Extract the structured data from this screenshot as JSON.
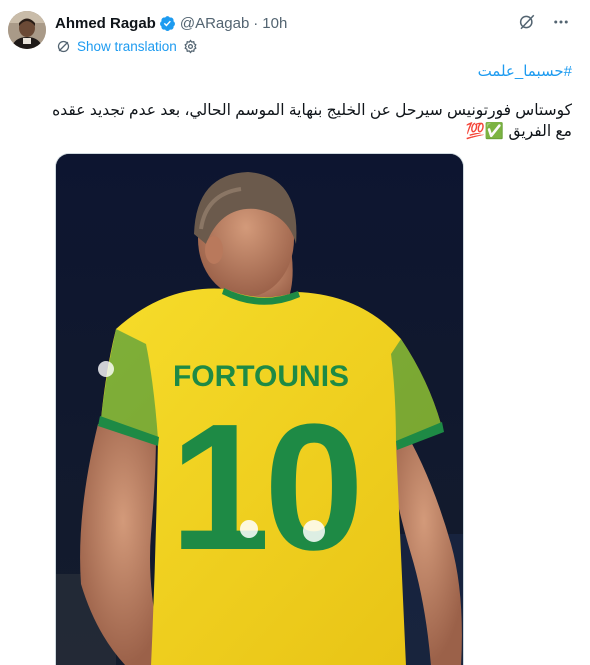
{
  "author": {
    "display_name": "Ahmed Ragab",
    "handle": "@ARagab",
    "separator": "·",
    "time": "10h",
    "verified": true
  },
  "actions": {
    "show_translation": "Show translation"
  },
  "tweet": {
    "hashtag": "#حسبما_علمت",
    "text": "كوستاس فورتونيس سيرحل عن الخليج بنهاية الموسم الحالي، بعد عدم تجديد عقده مع الفريق ✅💯"
  },
  "media": {
    "jersey_name": "FORTOUNIS",
    "jersey_number": "10"
  },
  "colors": {
    "link": "#1d9bf0",
    "verified": "#1d9bf0",
    "jersey_yellow": "#f2d31b",
    "jersey_green": "#1e8a45"
  },
  "icons": [
    "verified-badge-icon",
    "grok-icon",
    "more-icon",
    "translate-icon",
    "settings-icon"
  ]
}
